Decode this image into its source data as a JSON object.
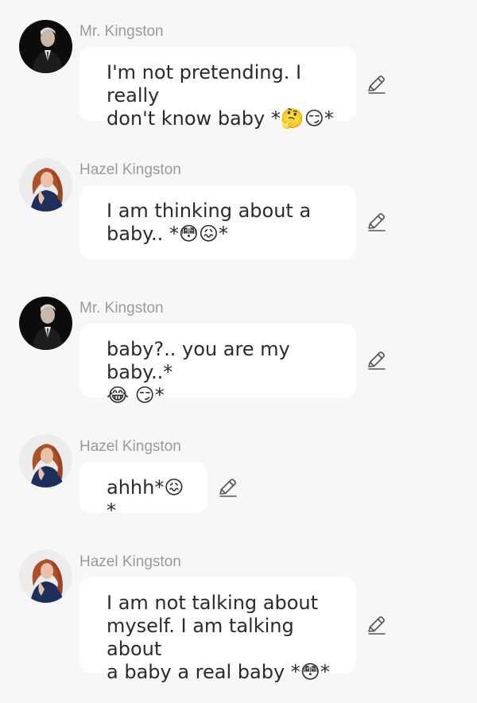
{
  "messages": [
    {
      "sender": "Mr. Kingston",
      "avatar": "man-in-suit-avatar",
      "text": "I'm not pretending. I really\ndon't know baby *🤔😏*"
    },
    {
      "sender": "Hazel Kingston",
      "avatar": "red-haired-woman-avatar",
      "text": "I am thinking about  a\nbaby.. *😳😖*"
    },
    {
      "sender": "Mr. Kingston",
      "avatar": "man-in-suit-avatar",
      "text": "baby?.. you are my baby..*\n😂 😏*"
    },
    {
      "sender": "Hazel Kingston",
      "avatar": "red-haired-woman-avatar",
      "text": "ahhh*😖*"
    },
    {
      "sender": "Hazel Kingston",
      "avatar": "red-haired-woman-avatar",
      "text": "I am not talking about\nmyself. I am talking about\na baby a real baby *😳*"
    }
  ],
  "icons": {
    "edit": "pencil-edit-icon"
  },
  "colors": {
    "background": "#f7f7f7",
    "bubble": "#ffffff",
    "name": "#9a9a9a",
    "text": "#2b2b2b"
  }
}
